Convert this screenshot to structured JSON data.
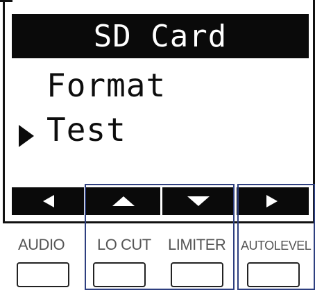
{
  "screen": {
    "title": "SD Card",
    "menu": [
      {
        "label": "Format",
        "selected": false
      },
      {
        "label": "Test",
        "selected": true
      }
    ],
    "nav_icons": [
      "left-arrow-icon",
      "up-arrow-icon",
      "down-arrow-icon",
      "right-arrow-icon"
    ]
  },
  "buttons": [
    {
      "label": "AUDIO"
    },
    {
      "label": "LO CUT"
    },
    {
      "label": "LIMITER"
    },
    {
      "label": "AUTOLEVEL"
    }
  ],
  "colors": {
    "lcd_background": "#ffffff",
    "lcd_ink": "#0a0a0a",
    "highlight": "#2e3f7f",
    "label_text": "#555555"
  }
}
